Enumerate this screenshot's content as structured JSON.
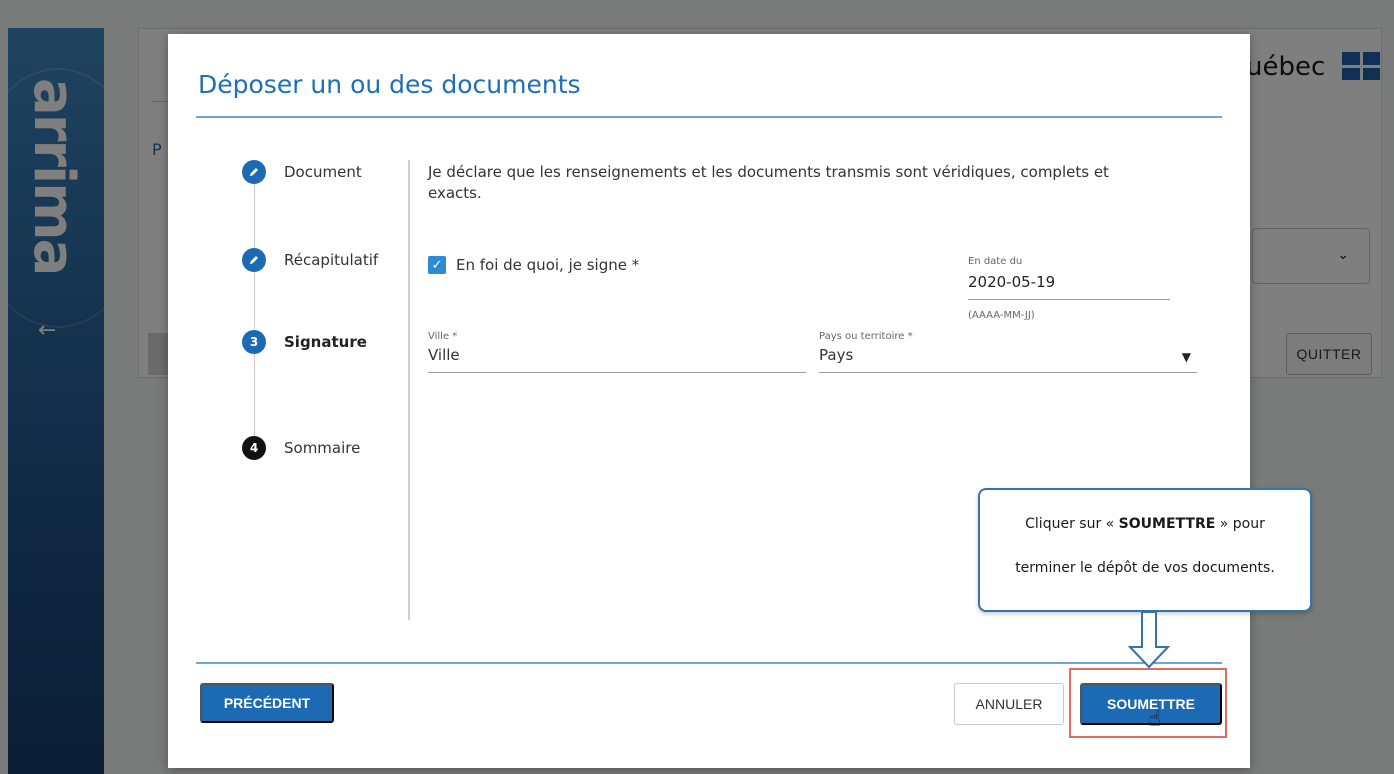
{
  "background_app": {
    "brand": "arrima",
    "back_icon": "arrow-left-icon",
    "gov_logo_text": "uébec",
    "quit_label": "QUITTER",
    "dropdown_icon": "chevron-down-icon",
    "fragment_letter": "P"
  },
  "modal": {
    "title": "Déposer un ou des documents",
    "steps": [
      {
        "number": "",
        "label": "Document",
        "status": "completed",
        "icon": "pencil-icon"
      },
      {
        "number": "",
        "label": "Récapitulatif",
        "status": "completed",
        "icon": "pencil-icon"
      },
      {
        "number": "3",
        "label": "Signature",
        "status": "current"
      },
      {
        "number": "4",
        "label": "Sommaire",
        "status": "pending"
      }
    ],
    "declaration": "Je déclare que les renseignements et les documents transmis sont véridiques, complets et exacts.",
    "sign_checkbox_label": "En foi de quoi, je signe *",
    "sign_checked": true,
    "date": {
      "label": "En date du",
      "value": "2020-05-19",
      "hint": "(AAAA-MM-JJ)"
    },
    "ville": {
      "label": "Ville *",
      "value": "Ville"
    },
    "pays": {
      "label": "Pays ou territoire *",
      "value": "Pays"
    },
    "buttons": {
      "previous": "PRÉCÉDENT",
      "cancel": "ANNULER",
      "submit": "SOUMETTRE"
    }
  },
  "callout": {
    "line1_pre": "Cliquer sur « ",
    "line1_bold": "SOUMETTRE",
    "line1_post": " » pour",
    "line2": "terminer le dépôt de vos documents."
  },
  "colors": {
    "primary": "#1c6ab3",
    "title_blue": "#1d6fb8",
    "highlight_red": "#e36a5c",
    "checkbox_blue": "#2d8bd6"
  }
}
